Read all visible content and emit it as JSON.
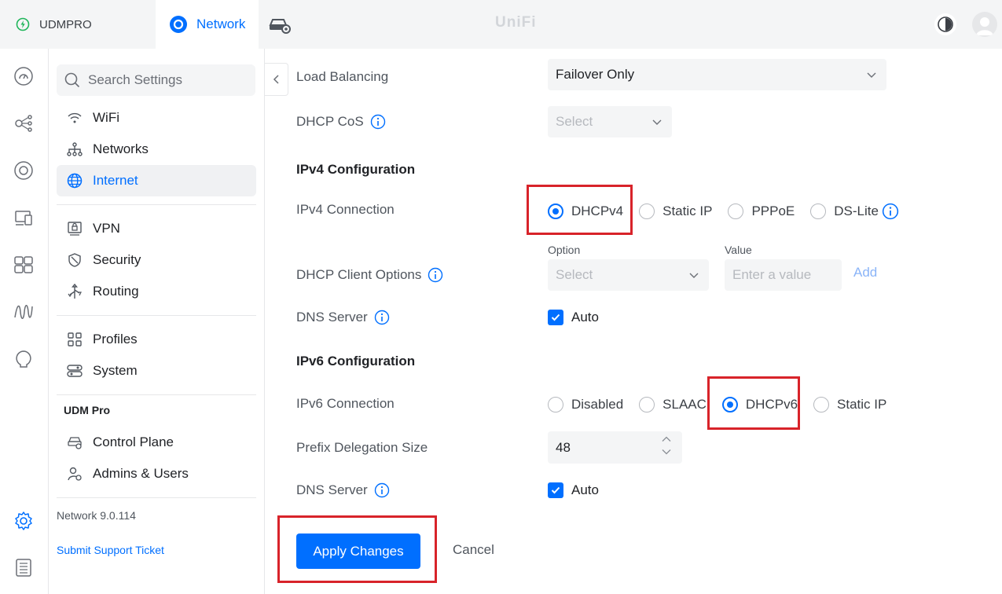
{
  "topbar": {
    "console_name": "UDMPRO",
    "app_tab": "Network",
    "brand": "UniFi",
    "colors": {
      "accent": "#006fff",
      "console_status": "#1fb55a"
    }
  },
  "rail": {
    "icons": [
      "dashboard-icon",
      "topology-icon",
      "devices-icon",
      "clients-icon",
      "ports-icon",
      "insights-icon",
      "alerts-icon",
      "settings-icon",
      "logs-icon"
    ]
  },
  "settings_nav": {
    "search_placeholder": "Search Settings",
    "items": [
      {
        "label": "WiFi",
        "icon": "wifi-icon"
      },
      {
        "label": "Networks",
        "icon": "networks-icon"
      },
      {
        "label": "Internet",
        "icon": "globe-icon",
        "active": true
      },
      {
        "label": "VPN",
        "icon": "vpn-icon"
      },
      {
        "label": "Security",
        "icon": "shield-icon"
      },
      {
        "label": "Routing",
        "icon": "routing-icon"
      },
      {
        "label": "Profiles",
        "icon": "profiles-icon"
      },
      {
        "label": "System",
        "icon": "system-icon"
      }
    ],
    "group_label": "UDM Pro",
    "group_items": [
      {
        "label": "Control Plane",
        "icon": "control-plane-icon"
      },
      {
        "label": "Admins & Users",
        "icon": "admins-icon"
      }
    ],
    "version": "Network 9.0.114",
    "support_link": "Submit Support Ticket"
  },
  "form": {
    "load_balancing": {
      "label": "Load Balancing",
      "value": "Failover Only"
    },
    "dhcp_cos": {
      "label": "DHCP CoS",
      "placeholder": "Select"
    },
    "ipv4_section": "IPv4 Configuration",
    "ipv4_connection": {
      "label": "IPv4 Connection",
      "options": [
        "DHCPv4",
        "Static IP",
        "PPPoE",
        "DS-Lite"
      ],
      "selected": "DHCPv4"
    },
    "dhcp_client_options": {
      "label": "DHCP Client Options",
      "option_label": "Option",
      "option_placeholder": "Select",
      "value_label": "Value",
      "value_placeholder": "Enter a value",
      "add": "Add"
    },
    "ipv4_dns": {
      "label": "DNS Server",
      "checkbox": "Auto",
      "checked": true
    },
    "ipv6_section": "IPv6 Configuration",
    "ipv6_connection": {
      "label": "IPv6 Connection",
      "options": [
        "Disabled",
        "SLAAC",
        "DHCPv6",
        "Static IP"
      ],
      "selected": "DHCPv6"
    },
    "prefix_delegation": {
      "label": "Prefix Delegation Size",
      "value": "48"
    },
    "ipv6_dns": {
      "label": "DNS Server",
      "checkbox": "Auto",
      "checked": true
    },
    "apply": "Apply Changes",
    "cancel": "Cancel"
  }
}
